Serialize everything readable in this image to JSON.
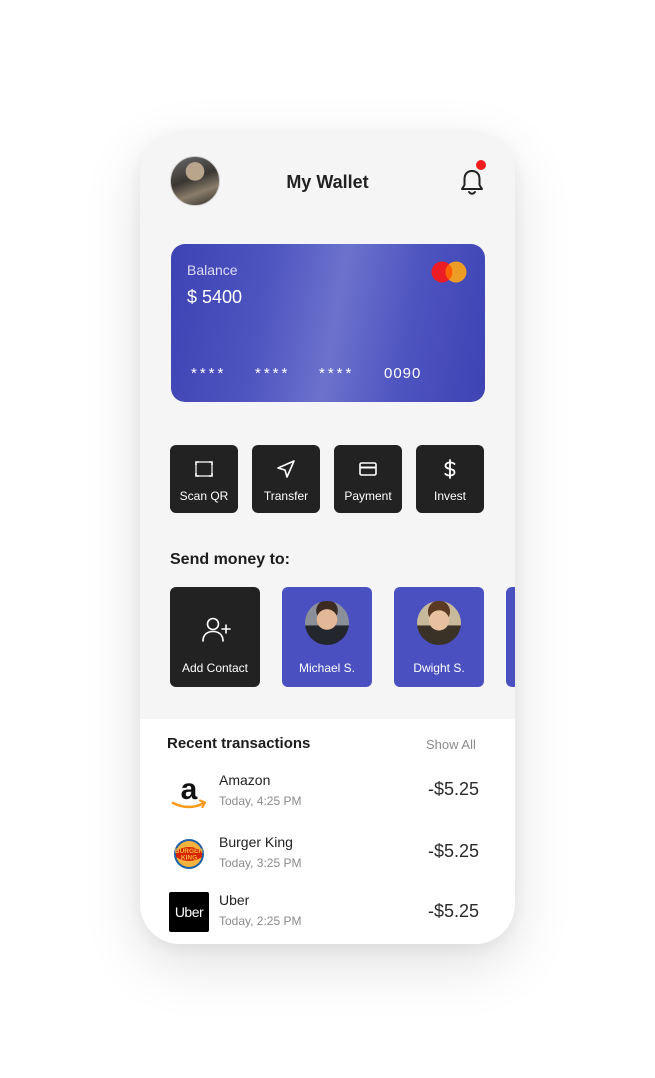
{
  "header": {
    "title": "My Wallet"
  },
  "card": {
    "balance_label": "Balance",
    "balance_value": "$ 5400",
    "groups": [
      "****",
      "****",
      "****",
      "0090"
    ],
    "brand_icon": "mastercard-icon"
  },
  "actions": [
    {
      "label": "Scan QR",
      "icon": "scan-qr-icon"
    },
    {
      "label": "Transfer",
      "icon": "send-arrow-icon"
    },
    {
      "label": "Payment",
      "icon": "credit-card-icon"
    },
    {
      "label": "Invest",
      "icon": "dollar-icon"
    }
  ],
  "send": {
    "title": "Send money to:",
    "add_label": "Add Contact",
    "contacts": [
      {
        "name": "Michael S."
      },
      {
        "name": "Dwight S."
      }
    ]
  },
  "recent": {
    "title": "Recent transactions",
    "show_all": "Show All",
    "items": [
      {
        "name": "Amazon",
        "time": "Today, 4:25 PM",
        "amount": "-$5.25",
        "logo": "amazon-logo"
      },
      {
        "name": "Burger King",
        "time": "Today, 3:25 PM",
        "amount": "-$5.25",
        "logo": "burger-king-logo"
      },
      {
        "name": "Uber",
        "time": "Today, 2:25 PM",
        "amount": "-$5.25",
        "logo": "uber-logo",
        "logo_text": "Uber"
      }
    ]
  },
  "colors": {
    "accent": "#4a50bf",
    "dark_tile": "#222222",
    "notification": "#f01d1d",
    "background": "#f5f5f5"
  }
}
